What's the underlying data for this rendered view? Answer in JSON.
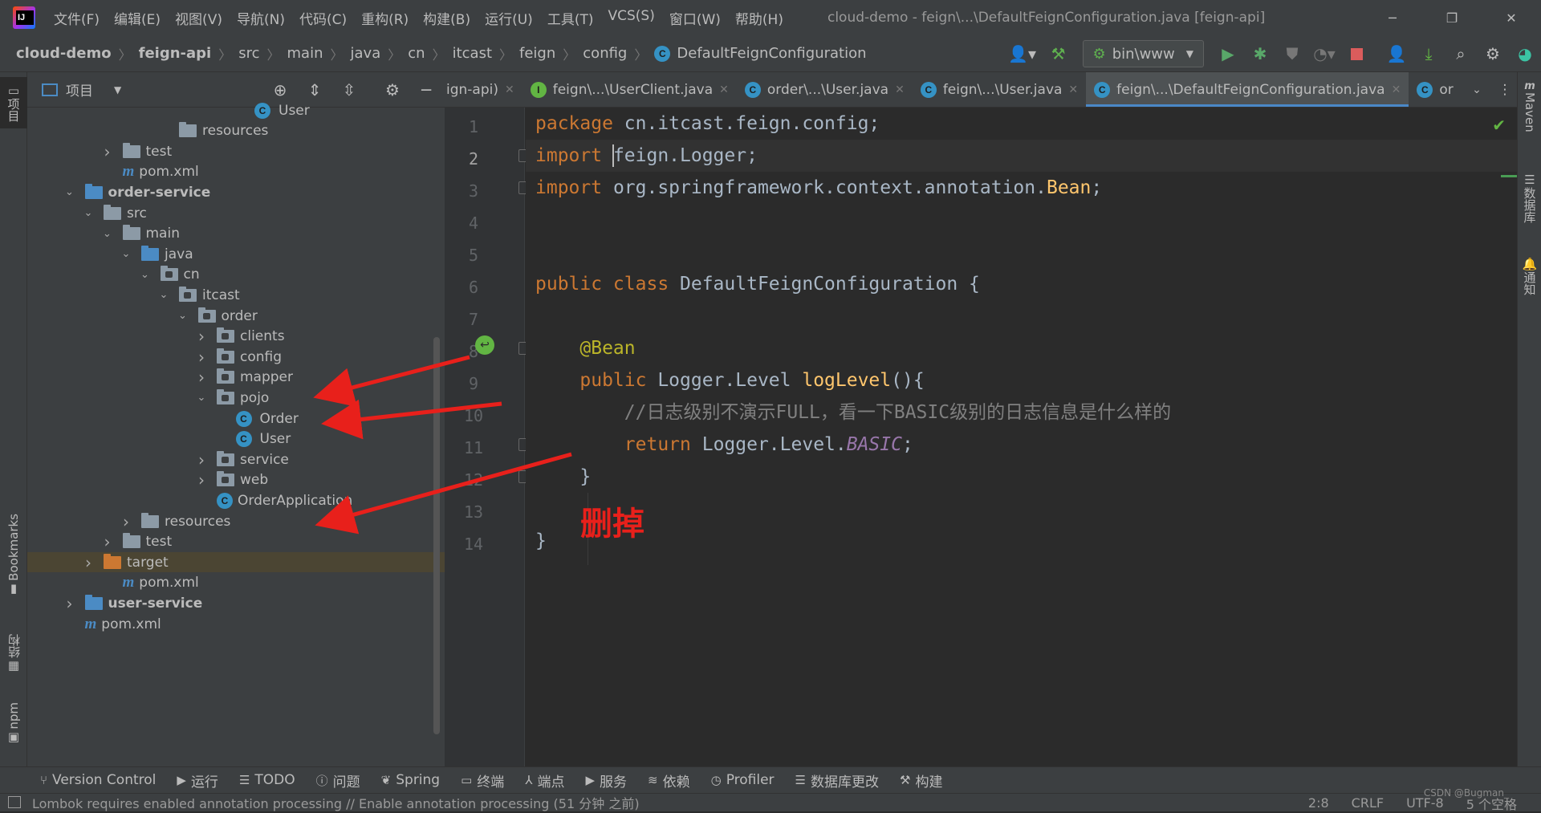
{
  "menu": [
    "文件(F)",
    "编辑(E)",
    "视图(V)",
    "导航(N)",
    "代码(C)",
    "重构(R)",
    "构建(B)",
    "运行(U)",
    "工具(T)",
    "VCS(S)",
    "窗口(W)",
    "帮助(H)"
  ],
  "window_title": "cloud-demo - feign\\...\\DefaultFeignConfiguration.java [feign-api]",
  "breadcrumb": [
    "cloud-demo",
    "feign-api",
    "src",
    "main",
    "java",
    "cn",
    "itcast",
    "feign",
    "config",
    "DefaultFeignConfiguration"
  ],
  "run_config": "bin\\www",
  "left_strip": {
    "project": "项目",
    "bookmarks": "Bookmarks",
    "structure": "结构",
    "npm": "npm"
  },
  "right_strip": {
    "maven": "Maven",
    "database": "数据库",
    "notifications": "通知"
  },
  "project_panel": {
    "title": "项目",
    "tree": [
      {
        "label": "User",
        "icon": "class"
      },
      {
        "label": "resources",
        "icon": "res"
      },
      {
        "label": "test",
        "icon": "folder",
        "expand": "collapsed"
      },
      {
        "label": "pom.xml",
        "icon": "maven"
      },
      {
        "label": "order-service",
        "icon": "module",
        "expand": "expanded",
        "bold": true
      },
      {
        "label": "src",
        "icon": "folder",
        "expand": "expanded"
      },
      {
        "label": "main",
        "icon": "folder",
        "expand": "expanded"
      },
      {
        "label": "java",
        "icon": "src",
        "expand": "expanded"
      },
      {
        "label": "cn",
        "icon": "pkg",
        "expand": "expanded"
      },
      {
        "label": "itcast",
        "icon": "pkg",
        "expand": "expanded"
      },
      {
        "label": "order",
        "icon": "pkg",
        "expand": "expanded"
      },
      {
        "label": "clients",
        "icon": "pkg",
        "expand": "collapsed"
      },
      {
        "label": "config",
        "icon": "pkg",
        "expand": "collapsed"
      },
      {
        "label": "mapper",
        "icon": "pkg",
        "expand": "collapsed"
      },
      {
        "label": "pojo",
        "icon": "pkg",
        "expand": "expanded"
      },
      {
        "label": "Order",
        "icon": "class"
      },
      {
        "label": "User",
        "icon": "class"
      },
      {
        "label": "service",
        "icon": "pkg",
        "expand": "collapsed"
      },
      {
        "label": "web",
        "icon": "pkg",
        "expand": "collapsed"
      },
      {
        "label": "OrderApplication",
        "icon": "app"
      },
      {
        "label": "resources",
        "icon": "res",
        "expand": "collapsed"
      },
      {
        "label": "test",
        "icon": "folder",
        "expand": "collapsed"
      },
      {
        "label": "target",
        "icon": "target",
        "expand": "collapsed",
        "selected": true
      },
      {
        "label": "pom.xml",
        "icon": "maven"
      },
      {
        "label": "user-service",
        "icon": "module",
        "expand": "collapsed",
        "bold": true
      },
      {
        "label": "pom.xml",
        "icon": "maven"
      }
    ]
  },
  "tabs": [
    {
      "label": "ign-api)",
      "icon": "none"
    },
    {
      "label": "feign\\...\\UserClient.java",
      "icon": "interface"
    },
    {
      "label": "order\\...\\User.java",
      "icon": "class"
    },
    {
      "label": "feign\\...\\User.java",
      "icon": "class"
    },
    {
      "label": "feign\\...\\DefaultFeignConfiguration.java",
      "icon": "class",
      "active": true
    },
    {
      "label": "or",
      "icon": "class"
    }
  ],
  "code": {
    "current_line": 2,
    "line_numbers": [
      "1",
      "2",
      "3",
      "4",
      "5",
      "6",
      "7",
      "8",
      "9",
      "10",
      "11",
      "12",
      "13",
      "14"
    ],
    "lines": [
      {
        "t": [
          [
            "kw",
            "package "
          ],
          [
            "",
            "cn.itcast.feign.config;"
          ]
        ]
      },
      {
        "t": [
          [
            "kw",
            "import "
          ],
          [
            "",
            "feign.Logger;"
          ]
        ]
      },
      {
        "t": [
          [
            "kw",
            "import "
          ],
          [
            "",
            "org.springframework.context.annotation."
          ],
          [
            "fn",
            "Bean"
          ],
          [
            "",
            ";"
          ]
        ]
      },
      {
        "t": []
      },
      {
        "t": []
      },
      {
        "t": [
          [
            "kw",
            "public class "
          ],
          [
            "",
            "DefaultFeignConfiguration {"
          ]
        ]
      },
      {
        "t": []
      },
      {
        "t": [
          [
            "ann",
            "    @Bean"
          ]
        ]
      },
      {
        "t": [
          [
            "kw",
            "    public "
          ],
          [
            "",
            "Logger.Level "
          ],
          [
            "fn",
            "logLevel"
          ],
          [
            "",
            "(){"
          ]
        ]
      },
      {
        "t": [
          [
            "cm",
            "        //日志级别不演示FULL，看一下BASIC级别的日志信息是什么样的"
          ]
        ]
      },
      {
        "t": [
          [
            "kw",
            "        return "
          ],
          [
            "",
            "Logger.Level."
          ],
          [
            "it",
            "BASIC"
          ],
          [
            "",
            ";"
          ]
        ]
      },
      {
        "t": [
          [
            "",
            "    }"
          ]
        ]
      },
      {
        "t": []
      },
      {
        "t": [
          [
            "",
            "}"
          ]
        ]
      }
    ]
  },
  "annotation_text": "删掉",
  "bottom_tools": [
    "Version Control",
    "运行",
    "TODO",
    "问题",
    "Spring",
    "终端",
    "端点",
    "服务",
    "依赖",
    "Profiler",
    "数据库更改",
    "构建"
  ],
  "status": {
    "message": "Lombok requires enabled annotation processing // Enable annotation processing (51 分钟 之前)",
    "position": "2:8",
    "line_sep": "CRLF",
    "encoding": "UTF-8",
    "indent": "5 个空格"
  },
  "watermark": "CSDN @Bugman_"
}
